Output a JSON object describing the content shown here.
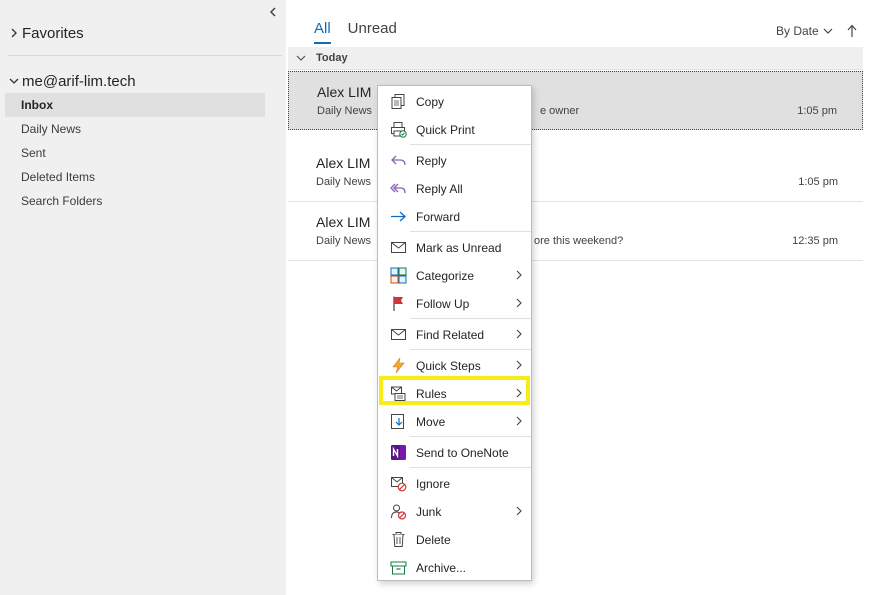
{
  "sidebar": {
    "favorites_label": "Favorites",
    "account_label": "me@arif-lim.tech",
    "folders": [
      "Inbox",
      "Daily News",
      "Sent",
      "Deleted Items",
      "Search Folders"
    ]
  },
  "tabs": {
    "all": "All",
    "unread": "Unread"
  },
  "sort": {
    "label": "By Date"
  },
  "group": {
    "label": "Today"
  },
  "messages": [
    {
      "sender": "Alex LIM",
      "preview_start": "Daily News",
      "preview_end": "e owner",
      "time": "1:05 pm"
    },
    {
      "sender": "Alex LIM",
      "preview_start": "Daily News",
      "preview_end": "",
      "time": "1:05 pm"
    },
    {
      "sender": "Alex LIM",
      "preview_start": "Daily News",
      "preview_end": "ore this weekend?",
      "time": "12:35 pm"
    }
  ],
  "context_menu": {
    "copy": "Copy",
    "quick_print": "Quick Print",
    "reply": "Reply",
    "reply_all": "Reply All",
    "forward": "Forward",
    "mark_unread": "Mark as Unread",
    "categorize": "Categorize",
    "follow_up": "Follow Up",
    "find_related": "Find Related",
    "quick_steps": "Quick Steps",
    "rules": "Rules",
    "move": "Move",
    "send_onenote": "Send to OneNote",
    "ignore": "Ignore",
    "junk": "Junk",
    "delete": "Delete",
    "archive": "Archive..."
  },
  "icons": [
    "chevron-left-icon",
    "chevron-right-icon",
    "chevron-down-icon",
    "sort-arrow-icon",
    "copy-icon",
    "print-icon",
    "reply-icon",
    "reply-all-icon",
    "forward-icon",
    "envelope-icon",
    "categorize-icon",
    "flag-icon",
    "find-related-icon",
    "lightning-icon",
    "rules-icon",
    "move-icon",
    "onenote-icon",
    "ignore-icon",
    "junk-icon",
    "trash-icon",
    "archive-icon"
  ],
  "colors": {
    "accent": "#0f6cbd",
    "highlight": "#f7ec19",
    "selected_bg": "#e0e0e0",
    "flag": "#d13438",
    "onenote": "#7719aa",
    "archive": "#107c41"
  }
}
